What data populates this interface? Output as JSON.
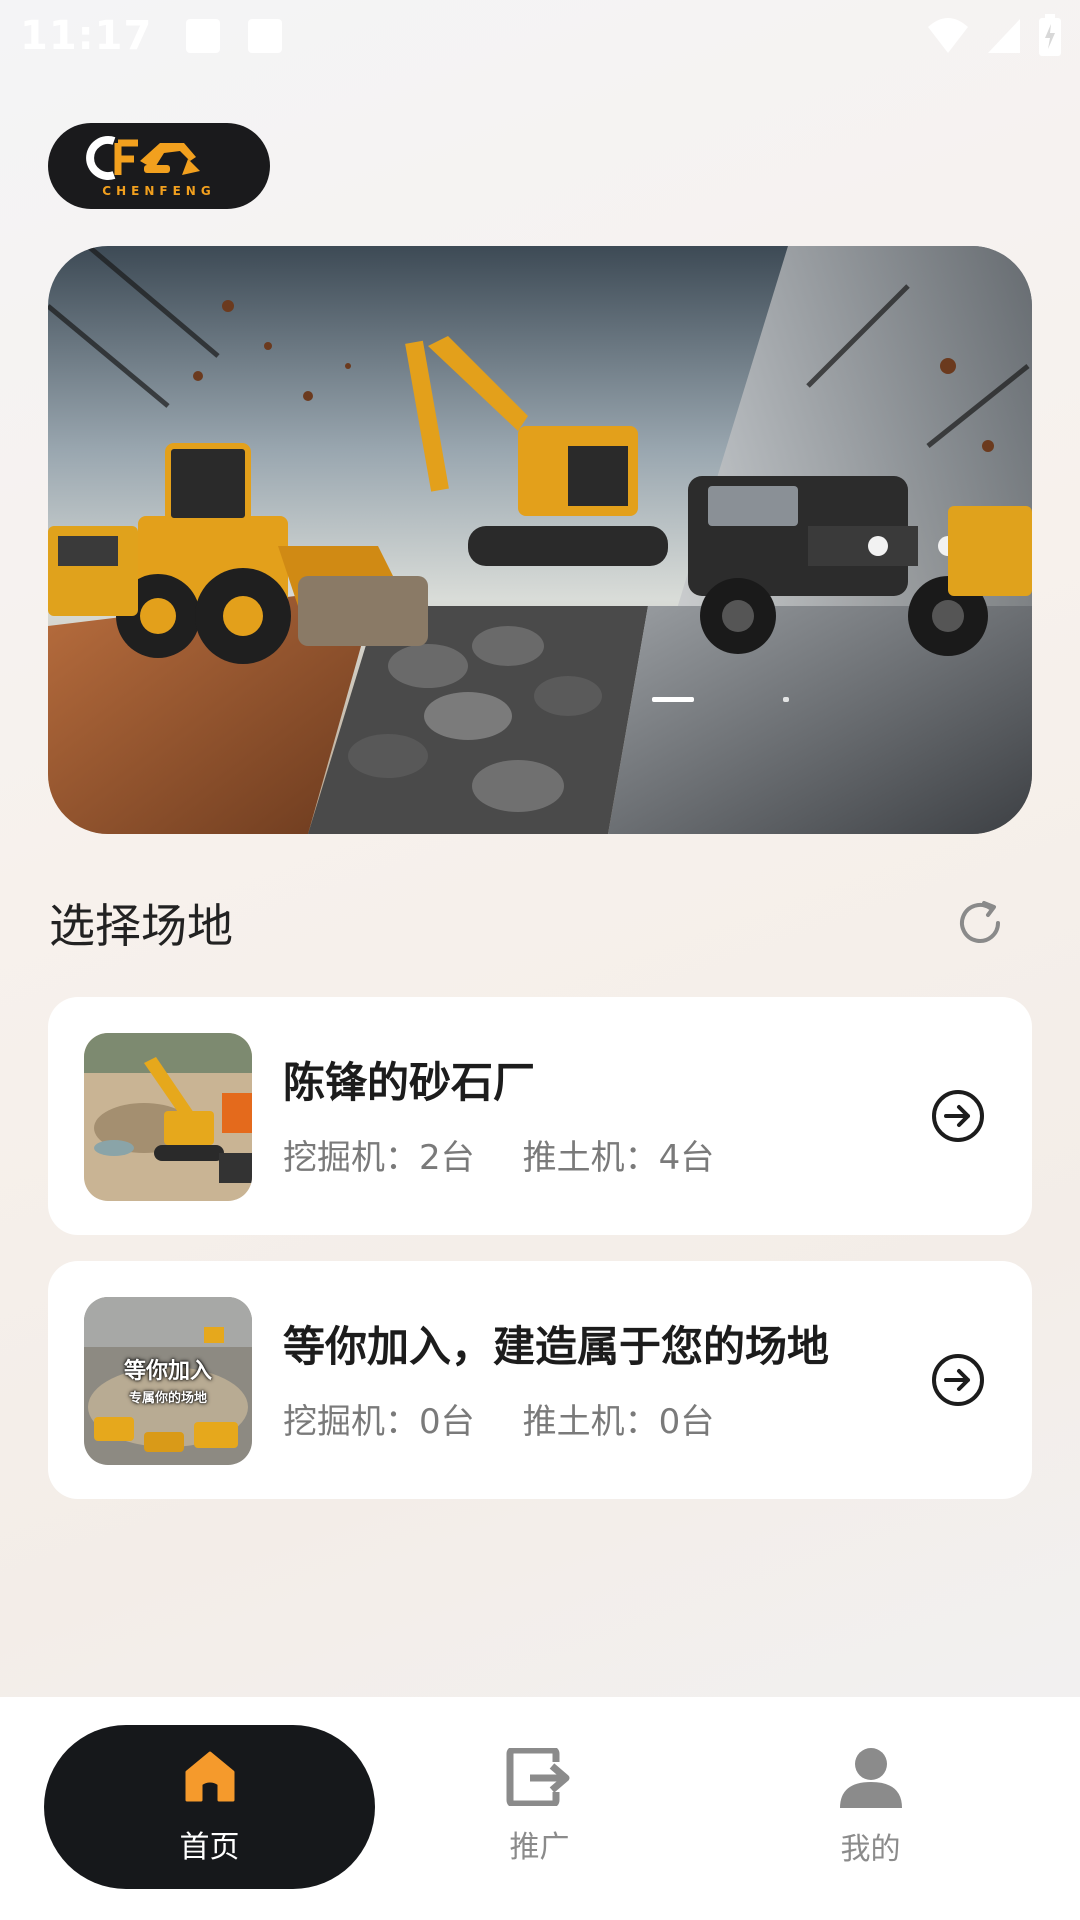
{
  "status_bar": {
    "time": "11:17"
  },
  "logo": {
    "brand_text": "CHENFENG",
    "accent_color": "#f2a01e"
  },
  "banner": {
    "active_indicator": 1
  },
  "section": {
    "title": "选择场地"
  },
  "sites": [
    {
      "name": "陈锋的砂石厂",
      "excavator": "挖掘机：2台",
      "bulldozer": "推土机：4台"
    },
    {
      "name": "等你加入，建造属于您的场地",
      "excavator": "挖掘机：0台",
      "bulldozer": "推土机：0台",
      "thumb_caption_1": "等你加入",
      "thumb_caption_2": "专属你的场地"
    }
  ],
  "bottom_nav": {
    "items": [
      {
        "label": "首页",
        "icon": "home-icon",
        "active": true
      },
      {
        "label": "推广",
        "icon": "share-icon",
        "active": false
      },
      {
        "label": "我的",
        "icon": "user-icon",
        "active": false
      }
    ],
    "active_icon_color": "#f59a2c",
    "inactive_icon_color": "#8b8b8b"
  }
}
